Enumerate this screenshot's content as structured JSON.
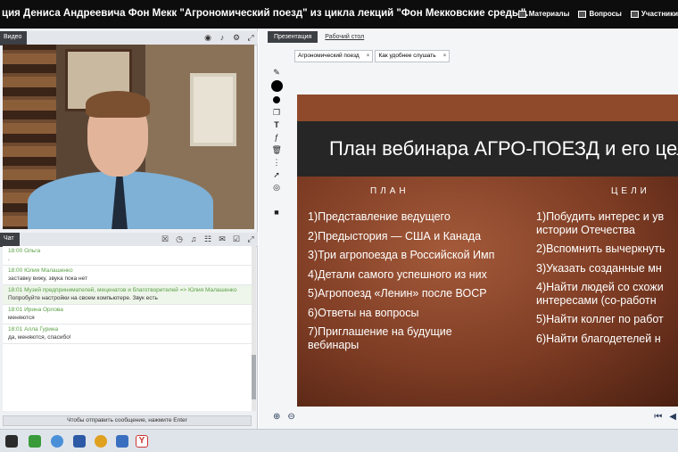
{
  "window": {
    "title": "ция Дениса Андреевича Фон Мекк \"Агрономический поезд\" из цикла лекций \"Фон Мекковские среды\"."
  },
  "header_links": [
    {
      "label": "Материалы",
      "icon": "materials-icon"
    },
    {
      "label": "Вопросы",
      "icon": "questions-icon"
    },
    {
      "label": "Участники",
      "icon": "participants-icon"
    }
  ],
  "video_panel": {
    "tab": "Видео"
  },
  "chat_panel": {
    "tab": "Чат",
    "messages": [
      {
        "header": "18:00 Ольга",
        "text": "."
      },
      {
        "header": "18:00 Юлия Малашенко",
        "text": "заставку вижу, звука пока нет"
      },
      {
        "header": "18:01 Музей предпринимателей, меценатов и благотворителей => Юлия Малашенко",
        "text": "Попробуйте настройки на своем компьютере. Звук есть",
        "highlight": true
      },
      {
        "header": "18:01 Ирина Орлова",
        "text": "меняются"
      },
      {
        "header": "18:01 Алла Гурина",
        "text": "да, меняются, спасибо!"
      }
    ],
    "input_placeholder": "Чтобы отправить сообщение, нажмите Enter"
  },
  "presentation": {
    "tabs": [
      "Презентация",
      "Рабочий стол"
    ],
    "doc_tabs": [
      "Агрономический поезд",
      "Как удобнее слушать"
    ],
    "close_symbol": "×",
    "slide": {
      "title": "План вебинара АГРО-ПОЕЗД и его цели",
      "plan_header": "ПЛАН",
      "goals_header": "ЦЕЛИ",
      "plan_items": [
        "1)Представление ведущего",
        "2)Предыстория — США и Канада",
        "3)Три агропоезда в Российской Имп",
        "4)Детали самого успешного из них",
        "5)Агропоезд «Ленин» после ВОСР",
        "6)Ответы на вопросы",
        "7)Приглашение на будущие вебинары"
      ],
      "goals_items": [
        "1)Побудить интерес и ув истории Отечества",
        "2)Вспомнить вычеркнуть",
        "3)Указать созданные мн",
        "4)Найти людей со схожи интересами (со-работн",
        "5)Найти коллег по работ",
        "6)Найти благодетелей н"
      ]
    }
  }
}
